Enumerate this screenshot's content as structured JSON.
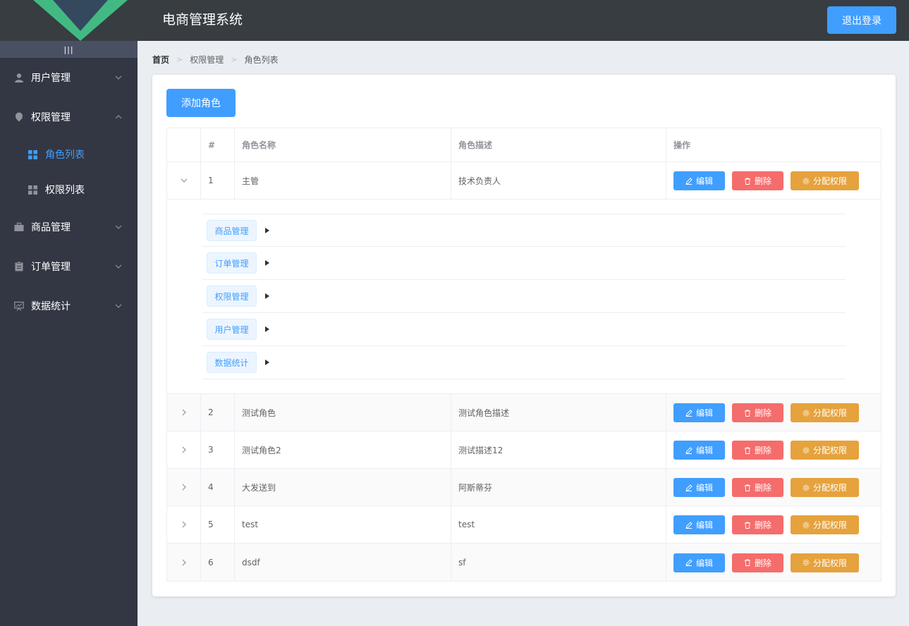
{
  "header": {
    "title": "电商管理系统",
    "logout_label": "退出登录"
  },
  "sidebar": {
    "toggle_label": "|||",
    "menus": [
      {
        "label": "用户管理",
        "icon": "user-icon",
        "expanded": false
      },
      {
        "label": "权限管理",
        "icon": "lock-icon",
        "expanded": true,
        "children": [
          {
            "label": "角色列表",
            "icon": "grid-icon",
            "active": true
          },
          {
            "label": "权限列表",
            "icon": "grid-icon",
            "active": false
          }
        ]
      },
      {
        "label": "商品管理",
        "icon": "briefcase-icon",
        "expanded": false
      },
      {
        "label": "订单管理",
        "icon": "clipboard-icon",
        "expanded": false
      },
      {
        "label": "数据统计",
        "icon": "chart-board-icon",
        "expanded": false
      }
    ]
  },
  "breadcrumb": [
    "首页",
    "权限管理",
    "角色列表"
  ],
  "add_role_label": "添加角色",
  "table": {
    "headers": [
      "",
      "#",
      "角色名称",
      "角色描述",
      "操作"
    ],
    "actions": {
      "edit": "编辑",
      "delete": "删除",
      "assign": "分配权限"
    },
    "rows": [
      {
        "index": "1",
        "name": "主管",
        "desc": "技术负责人",
        "expanded": true
      },
      {
        "index": "2",
        "name": "测试角色",
        "desc": "测试角色描述",
        "expanded": false
      },
      {
        "index": "3",
        "name": "测试角色2",
        "desc": "测试描述12",
        "expanded": false
      },
      {
        "index": "4",
        "name": "大发送到",
        "desc": "阿斯蒂芬",
        "expanded": false
      },
      {
        "index": "5",
        "name": "test",
        "desc": "test",
        "expanded": false
      },
      {
        "index": "6",
        "name": "dsdf",
        "desc": "sf",
        "expanded": false
      }
    ],
    "expanded_permissions": [
      "商品管理",
      "订单管理",
      "权限管理",
      "用户管理",
      "数据统计"
    ]
  },
  "colors": {
    "primary": "#409eff",
    "danger": "#f56c6c",
    "warning": "#e6a23c",
    "header_bg": "#373d41",
    "sidebar_bg": "#333744",
    "main_bg": "#eaedf1",
    "logo_green": "#42b983",
    "logo_dark": "#35495e"
  }
}
